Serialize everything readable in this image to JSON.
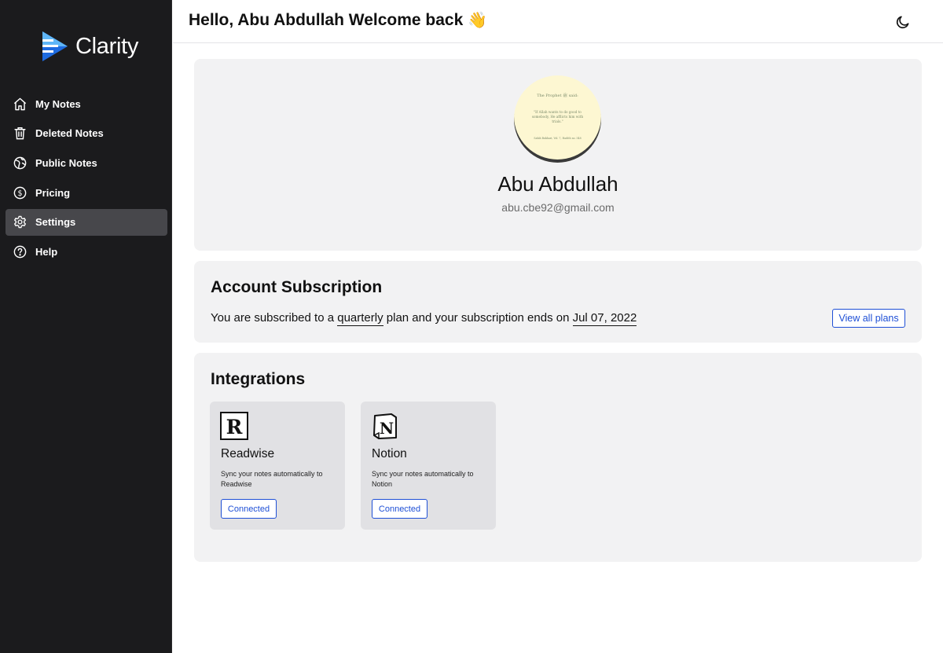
{
  "app": {
    "name": "Clarity",
    "brand_color": "#3b82f6"
  },
  "sidebar": {
    "items": [
      {
        "label": "My Notes",
        "icon": "home-icon",
        "active": false
      },
      {
        "label": "Deleted Notes",
        "icon": "trash-icon",
        "active": false
      },
      {
        "label": "Public Notes",
        "icon": "globe-icon",
        "active": false
      },
      {
        "label": "Pricing",
        "icon": "dollar-icon",
        "active": false
      },
      {
        "label": "Settings",
        "icon": "gear-icon",
        "active": true
      },
      {
        "label": "Help",
        "icon": "help-icon",
        "active": false
      }
    ]
  },
  "header": {
    "greeting": "Hello, Abu Abdullah Welcome back",
    "wave_emoji": "👋",
    "theme_toggle_icon": "moon-icon"
  },
  "profile": {
    "name": "Abu Abdullah",
    "email": "abu.cbe92@gmail.com",
    "avatar_text": {
      "line1": "The Prophet ﷺ said:",
      "line2": "\"If Allah wants to do good to somebody, He afflicts him with trials.\"",
      "line3": "Sahih Bukhari, Vol. 7, Hadith no. 548"
    }
  },
  "subscription": {
    "title": "Account Subscription",
    "text_prefix": "You are subscribed to a",
    "plan": "quarterly",
    "text_middle": "plan and your subscription ends on",
    "end_date": "Jul 07, 2022",
    "view_plans_label": "View all plans"
  },
  "integrations": {
    "title": "Integrations",
    "items": [
      {
        "name": "Readwise",
        "description": "Sync your notes automatically to Readwise",
        "status": "Connected",
        "icon": "readwise-logo-icon"
      },
      {
        "name": "Notion",
        "description": "Sync your notes automatically to Notion",
        "status": "Connected",
        "icon": "notion-logo-icon"
      }
    ]
  },
  "colors": {
    "sidebar_bg": "#1b1b1d",
    "active_item_bg": "#47474b",
    "link_blue": "#1e4fd6",
    "card_bg": "#f2f2f3"
  }
}
